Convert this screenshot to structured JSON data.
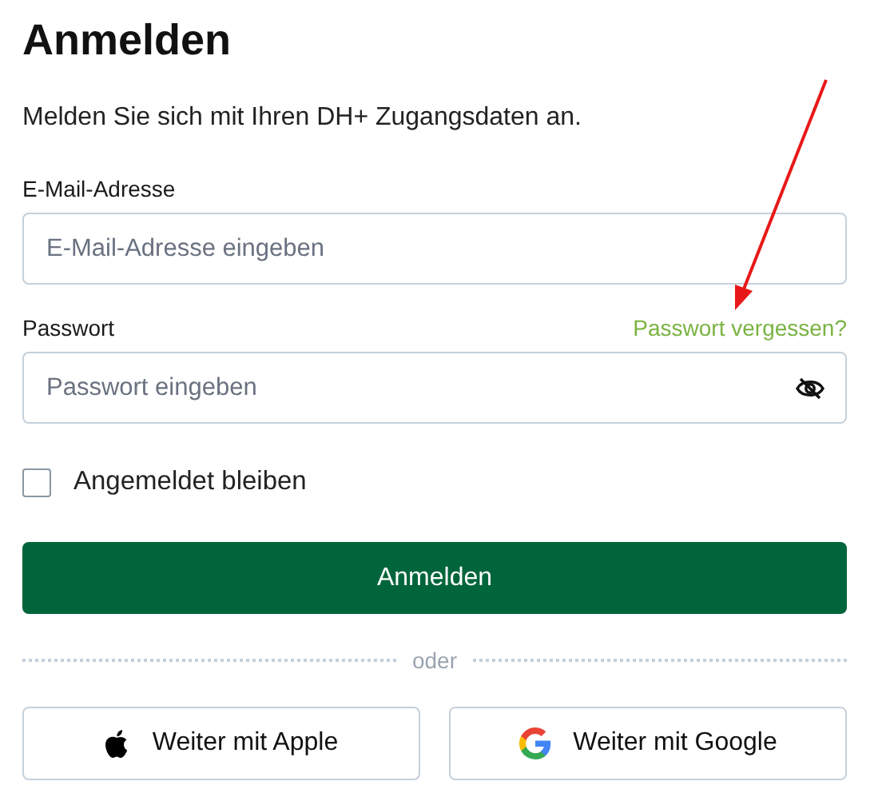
{
  "title": "Anmelden",
  "subtitle": "Melden Sie sich mit Ihren DH+ Zugangsdaten an.",
  "email": {
    "label": "E-Mail-Adresse",
    "placeholder": "E-Mail-Adresse eingeben"
  },
  "password": {
    "label": "Passwort",
    "forgot_link": "Passwort vergessen?",
    "placeholder": "Passwort eingeben"
  },
  "remember": {
    "label": "Angemeldet bleiben",
    "checked": false
  },
  "submit": "Anmelden",
  "divider": "oder",
  "social_buttons": [
    {
      "kind": "apple",
      "label": "Weiter mit Apple"
    },
    {
      "kind": "google",
      "label": "Weiter mit Google"
    }
  ]
}
